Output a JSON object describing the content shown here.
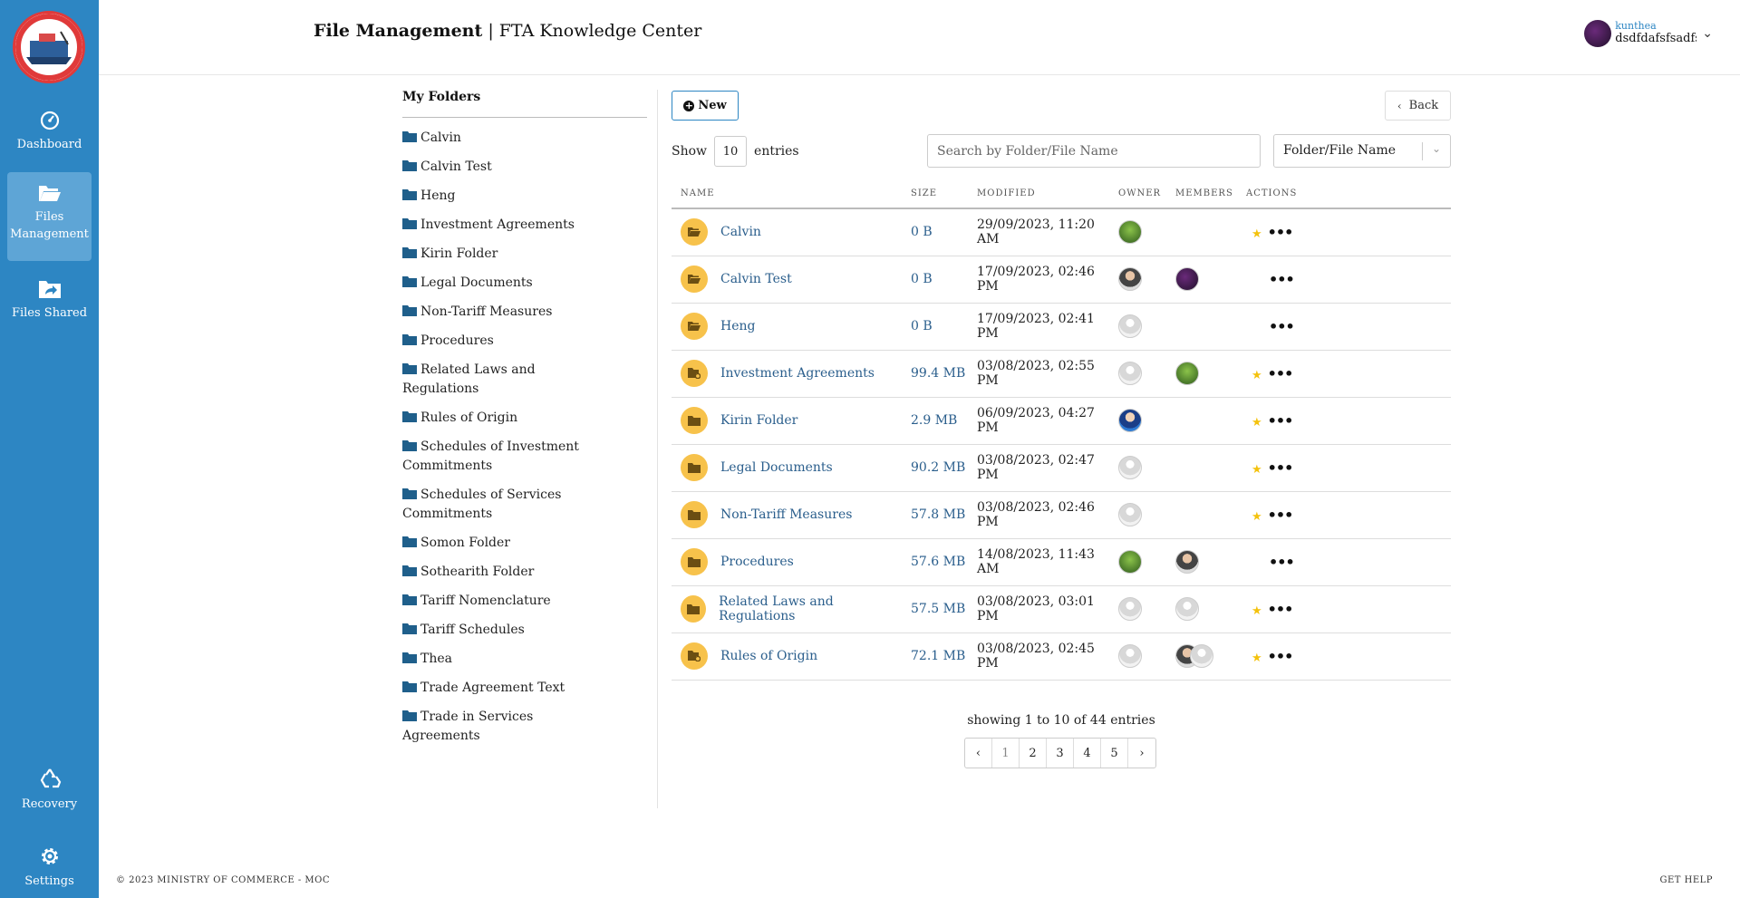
{
  "header": {
    "title_bold": "File Management",
    "title_rest": "| FTA Knowledge Center"
  },
  "user": {
    "name": "kunthea",
    "email": "dsdfdafsfsadfsl"
  },
  "sidebar": {
    "items": [
      {
        "label": "Dashboard",
        "icon": "dashboard-icon"
      },
      {
        "label": "Files Management",
        "icon": "folder-open-icon"
      },
      {
        "label": "Files Shared",
        "icon": "folder-share-icon"
      },
      {
        "label": "Recovery",
        "icon": "recycle-icon"
      },
      {
        "label": "Settings",
        "icon": "gear-icon"
      }
    ]
  },
  "tree": {
    "title": "My Folders",
    "items": [
      "Calvin",
      "Calvin Test",
      "Heng",
      "Investment Agreements",
      "Kirin Folder",
      "Legal Documents",
      "Non-Tariff Measures",
      "Procedures",
      "Related Laws and Regulations",
      "Rules of Origin",
      "Schedules of Investment Commitments",
      "Schedules of Services Commitments",
      "Somon Folder",
      "Sothearith Folder",
      "Tariff Nomenclature",
      "Tariff Schedules",
      "Thea",
      "Trade Agreement Text",
      "Trade in Services Agreements"
    ]
  },
  "toolbar": {
    "new_label": "New",
    "back_label": "Back",
    "show_label": "Show",
    "entries_value": "10",
    "entries_label": "entries",
    "search_placeholder": "Search by Folder/File Name",
    "filter_value": "Folder/File Name"
  },
  "table": {
    "headers": [
      "NAME",
      "SIZE",
      "MODIFIED",
      "OWNER",
      "MEMBERS",
      "ACTIONS"
    ],
    "rows": [
      {
        "name": "Calvin",
        "size": "0 B",
        "modified": "29/09/2023, 11:20 AM",
        "owner": "green",
        "members": [],
        "starred": true,
        "icon": "folder-open-icon"
      },
      {
        "name": "Calvin Test",
        "size": "0 B",
        "modified": "17/09/2023, 02:46 PM",
        "owner": "photo",
        "members": [
          "purple"
        ],
        "starred": false,
        "icon": "folder-open-icon"
      },
      {
        "name": "Heng",
        "size": "0 B",
        "modified": "17/09/2023, 02:41 PM",
        "owner": "gray",
        "members": [],
        "starred": false,
        "icon": "folder-open-icon"
      },
      {
        "name": "Investment Agreements",
        "size": "99.4 MB",
        "modified": "03/08/2023, 02:55 PM",
        "owner": "gray",
        "members": [
          "green"
        ],
        "starred": true,
        "icon": "folder-shared-icon"
      },
      {
        "name": "Kirin Folder",
        "size": "2.9 MB",
        "modified": "06/09/2023, 04:27 PM",
        "owner": "blue",
        "members": [],
        "starred": true,
        "icon": "folder-icon"
      },
      {
        "name": "Legal Documents",
        "size": "90.2 MB",
        "modified": "03/08/2023, 02:47 PM",
        "owner": "gray",
        "members": [],
        "starred": true,
        "icon": "folder-icon"
      },
      {
        "name": "Non-Tariff Measures",
        "size": "57.8 MB",
        "modified": "03/08/2023, 02:46 PM",
        "owner": "gray",
        "members": [],
        "starred": true,
        "icon": "folder-icon"
      },
      {
        "name": "Procedures",
        "size": "57.6 MB",
        "modified": "14/08/2023, 11:43 AM",
        "owner": "green",
        "members": [
          "photo"
        ],
        "starred": false,
        "icon": "folder-icon"
      },
      {
        "name": "Related Laws and Regulations",
        "size": "57.5 MB",
        "modified": "03/08/2023, 03:01 PM",
        "owner": "gray",
        "members": [
          "gray"
        ],
        "starred": true,
        "icon": "folder-icon"
      },
      {
        "name": "Rules of Origin",
        "size": "72.1 MB",
        "modified": "03/08/2023, 02:45 PM",
        "owner": "gray",
        "members": [
          "photo",
          "gray"
        ],
        "starred": true,
        "icon": "folder-shared-icon"
      }
    ]
  },
  "pagination": {
    "summary": "showing 1 to 10 of 44 entries",
    "pages": [
      "1",
      "2",
      "3",
      "4",
      "5"
    ],
    "current": "1"
  },
  "footer": {
    "copyright": "© 2023 MINISTRY OF COMMERCE - MOC",
    "help": "GET HELP"
  },
  "colors": {
    "sidebar": "#2d86c3",
    "sidebar_active": "#5ea5d6",
    "folder_badge": "#f7c24b",
    "link": "#2a5e8c",
    "star": "#f4c20d"
  }
}
